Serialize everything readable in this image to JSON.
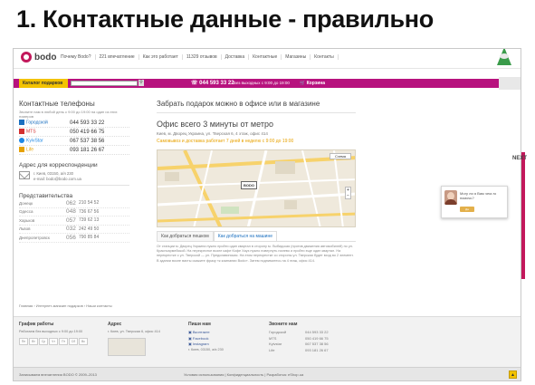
{
  "slide": {
    "title": "1. Контактные данные - правильно"
  },
  "header": {
    "logo_text": "bodo",
    "nav": [
      "Почему Bodo?",
      "221 впечатление",
      "Как это работает",
      "11329 отзывов",
      "Доставка",
      "Контактные",
      "Магазины",
      "Контакты"
    ],
    "catalog_label": "Каталог подарков",
    "search_placeholder": "",
    "phone": "044 593 33 22",
    "hours": "Без выходных с 9:00 до 19:00",
    "cart_label": "Корзина"
  },
  "contacts": {
    "title": "Контактные телефоны",
    "subtitle": "Звоните нам в любой день с 9:00 до 19:00 на один из этих номеров",
    "phones": [
      {
        "operator": "Городской",
        "prefix": "",
        "number": "044 593 33 22"
      },
      {
        "operator": "MTS",
        "prefix": "",
        "number": "050 419 66 75"
      },
      {
        "operator": "KyivStar",
        "prefix": "",
        "number": "067 537 38 56"
      },
      {
        "operator": "Life",
        "prefix": "",
        "number": "093 181 26 67"
      }
    ],
    "mail_title": "Адрес для корреспонденции",
    "mail_lines": [
      "г. Киев, 03150, а/я 230",
      "e-mail: bodo@bodo.com.ua"
    ],
    "reps_title": "Представительства",
    "reps": [
      {
        "city": "Донецк",
        "prefix": "062",
        "number": "210 54 52"
      },
      {
        "city": "Одесса",
        "prefix": "048",
        "number": "736 67 56"
      },
      {
        "city": "Харьков",
        "prefix": "057",
        "number": "739 62 13"
      },
      {
        "city": "Львов",
        "prefix": "032",
        "number": "242 49 50"
      },
      {
        "city": "Днепропетровск",
        "prefix": "056",
        "number": "790 85 84"
      }
    ]
  },
  "main": {
    "take_title": "Забрать подарок можно в офисе или в магазине",
    "office_title": "Офис всего 3 минуты от метро",
    "office_address": "Киев, м. Дворец Украина, ул. Тверская 6, 4 этаж, офис 414",
    "office_hours": "Самовывоз и доставка работает 7 дней в неделю с 9:00 до 19:00",
    "map_marker": "BODO",
    "map_button": "Схема",
    "tabs": [
      "Как добраться пешком",
      "Как добраться на машине"
    ],
    "directions": "От станции м. Дворец Украина нужно пройти один квартал в сторону м. Лыбидская (против движения автомобилей) по ул. Красноармейской. На перекрестке возле кафе Кофе Хауз нужно повернуть налево и пройти еще один квартал. На перекрестке с ул. Тверской — ул. Предславинская. На этом перекрестке со стороны ул. Тверская будет вход во 2 элемент. В здании возле вахты скажите фразу «к компании Bodo». Затем поднимитесь на 4 этаж, офис 414."
  },
  "breadcrumb": "Главная › Интернет-магазин подарков › Наши контакты",
  "footer": {
    "schedule_title": "График работы",
    "schedule_text": "Работаем без выходных с 9:00 до 19:00",
    "days": [
      "Пн",
      "Вт",
      "Ср",
      "Чт",
      "Пт",
      "Сб",
      "Вс"
    ],
    "address_title": "Адрес",
    "address_text": "г. Киев, ул. Тверская 6, офис 414",
    "social_title": "Пиши нам",
    "social": [
      "Вконтакте",
      "Facebook",
      "Instagram",
      "г. Киев, 03150, а/я 230"
    ],
    "phones_title": "Звоните нам",
    "phones": [
      {
        "operator": "Городской",
        "number": "044 593 33 22"
      },
      {
        "operator": "MTS",
        "number": "050 419 66 75"
      },
      {
        "operator": "Kyivstar",
        "number": "067 537 38 56"
      },
      {
        "operator": "Life",
        "number": "093 181 26 67"
      }
    ]
  },
  "bottom": {
    "copyright": "Записываем впечатления BODO © 2009–2013",
    "legal": "Условия использования | Конфиденциальность | Разработка: eShop.ua"
  },
  "chat": {
    "text": "Могу ли я Вам чем-то помочь?",
    "button": "Да",
    "next_label": "NEXT"
  },
  "colors": {
    "brand": "#b7127e",
    "accent": "#f3c300",
    "map": "#efe9dc"
  }
}
